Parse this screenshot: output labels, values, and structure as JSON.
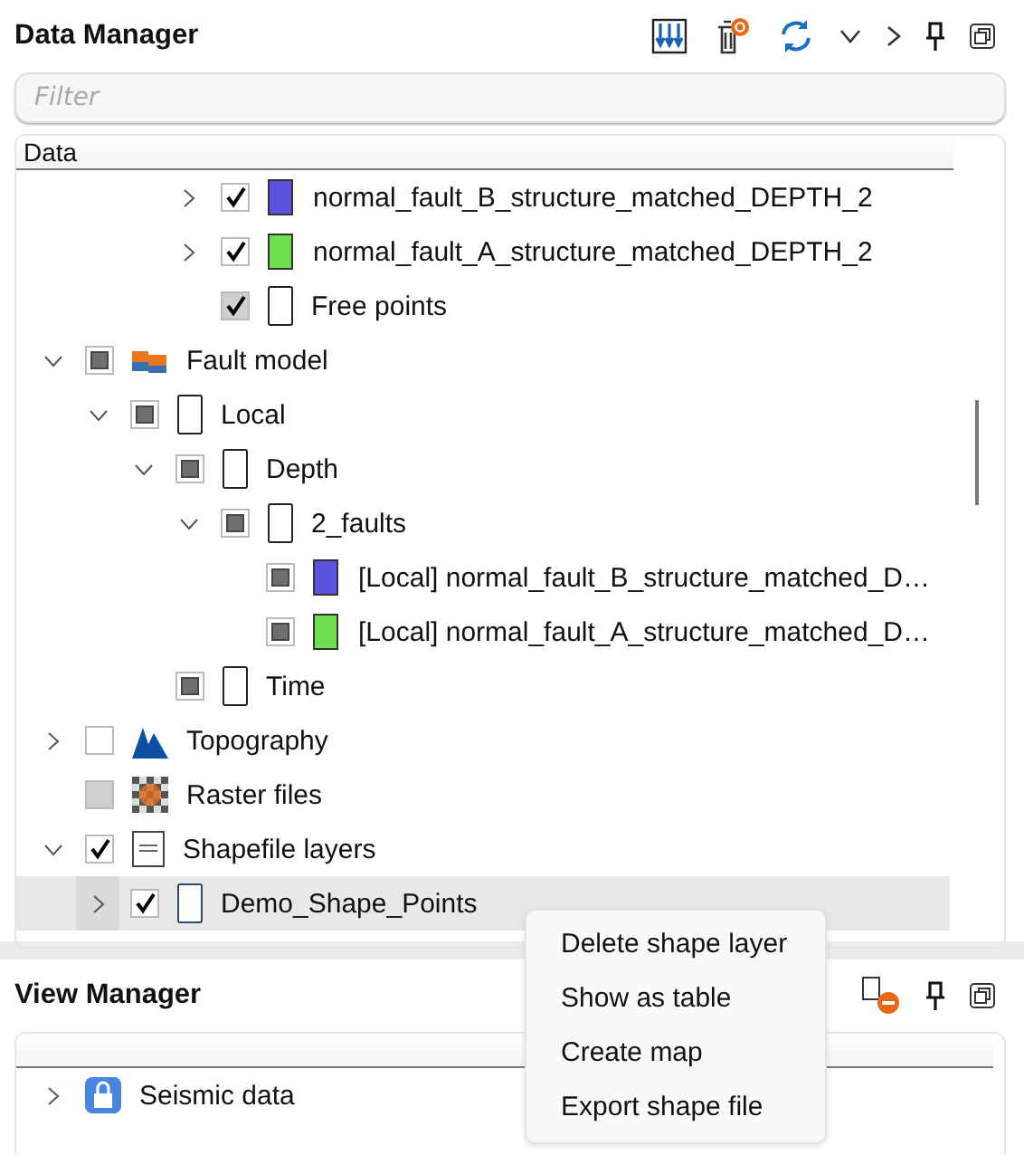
{
  "data_manager": {
    "title": "Data Manager",
    "filter": {
      "placeholder": "Filter"
    },
    "column_header": "Data",
    "partial_rows": [
      {
        "label": "normal_fault_B_structure_matched_DEPTH_2",
        "expanded": false,
        "checked": true,
        "mixed": false,
        "disabled": false,
        "kind": "swatch",
        "color": "#5b52e0"
      },
      {
        "label": "normal_fault_A_structure_matched_DEPTH_2",
        "expanded": false,
        "checked": true,
        "mixed": false,
        "disabled": false,
        "kind": "swatch",
        "color": "#6ee04f"
      },
      {
        "label": "Free points",
        "checked": true,
        "mixed": false,
        "disabled": true,
        "kind": "doc"
      }
    ],
    "items": [
      {
        "label": "Fault model",
        "expanded": true,
        "checked": false,
        "mixed": true,
        "disabled": false,
        "kind": "fault-model",
        "selected": false,
        "children": [
          {
            "label": "Local",
            "expanded": true,
            "checked": false,
            "mixed": true,
            "disabled": false,
            "kind": "doc",
            "selected": false,
            "children": [
              {
                "label": "Depth",
                "expanded": true,
                "checked": false,
                "mixed": true,
                "disabled": false,
                "kind": "doc",
                "selected": false,
                "children": [
                  {
                    "label": "2_faults",
                    "expanded": true,
                    "checked": false,
                    "mixed": true,
                    "disabled": false,
                    "kind": "doc",
                    "selected": false,
                    "children": [
                      {
                        "label": "[Local] normal_fault_B_structure_matched_D…",
                        "checked": false,
                        "mixed": true,
                        "disabled": false,
                        "kind": "swatch",
                        "color": "#5b52e0",
                        "selected": false
                      },
                      {
                        "label": "[Local] normal_fault_A_structure_matched_D…",
                        "checked": false,
                        "mixed": true,
                        "disabled": false,
                        "kind": "swatch",
                        "color": "#6ee04f",
                        "selected": false
                      }
                    ]
                  }
                ]
              },
              {
                "label": "Time",
                "checked": false,
                "mixed": true,
                "disabled": false,
                "kind": "doc",
                "selected": false
              }
            ]
          }
        ]
      },
      {
        "label": "Topography",
        "expanded": false,
        "checked": false,
        "mixed": false,
        "disabled": false,
        "kind": "mountain",
        "selected": false
      },
      {
        "label": "Raster files",
        "checked": false,
        "mixed": false,
        "disabled": true,
        "kind": "raster",
        "selected": false
      },
      {
        "label": "Shapefile layers",
        "expanded": true,
        "checked": true,
        "mixed": false,
        "disabled": false,
        "kind": "shp",
        "selected": false,
        "children": [
          {
            "label": "Demo_Shape_Points",
            "expanded": false,
            "checked": true,
            "mixed": false,
            "disabled": false,
            "kind": "doc-dark",
            "selected": true
          }
        ]
      }
    ]
  },
  "view_manager": {
    "title": "View Manager",
    "items": [
      {
        "label": "Seismic data",
        "expanded": false,
        "kind": "lock"
      }
    ]
  },
  "context_menu": [
    "Delete shape layer",
    "Show as table",
    "Create map",
    "Export shape file"
  ]
}
